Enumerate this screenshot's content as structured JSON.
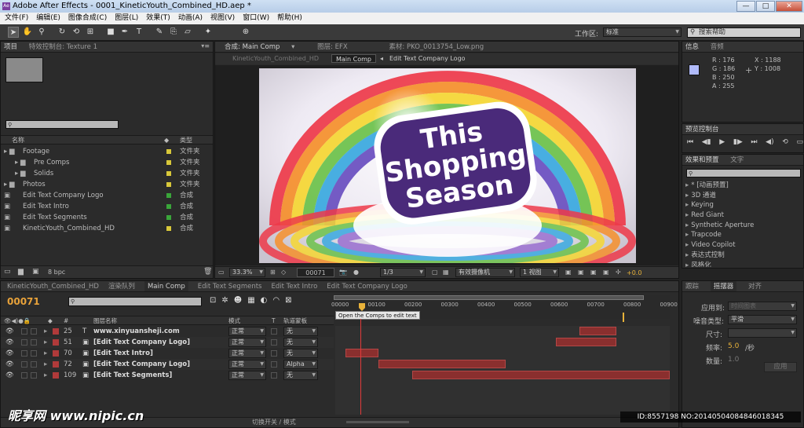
{
  "window": {
    "title": "Adobe After Effects - 0001_KineticYouth_Combined_HD.aep *",
    "app_icon": "Ae",
    "minimize": "—",
    "maximize": "□",
    "close": "✕"
  },
  "menu": [
    "文件(F)",
    "编辑(E)",
    "图像合成(C)",
    "图层(L)",
    "效果(T)",
    "动画(A)",
    "视图(V)",
    "窗口(W)",
    "帮助(H)"
  ],
  "toolbar": {
    "workspace_label": "工作区:",
    "workspace_value": "标准",
    "search_placeholder": "搜索帮助"
  },
  "project": {
    "tabs": [
      "项目",
      "特效控制台: Texture 1"
    ],
    "col_name": "名称",
    "col_type": "类型",
    "bpc": "8 bpc",
    "items": [
      {
        "name": "Footage",
        "type": "文件夹",
        "color": "#d8c83a",
        "icon": "▸ ▆",
        "indent": 0
      },
      {
        "name": "Pre Comps",
        "type": "文件夹",
        "color": "#d8c83a",
        "icon": "▸ ▆",
        "indent": 1
      },
      {
        "name": "Solids",
        "type": "文件夹",
        "color": "#d8c83a",
        "icon": "▸ ▆",
        "indent": 1
      },
      {
        "name": "Photos",
        "type": "文件夹",
        "color": "#d8c83a",
        "icon": "▸ ▆",
        "indent": 0
      },
      {
        "name": "Edit Text Company Logo",
        "type": "合成",
        "color": "#3aa63a",
        "icon": "▣",
        "indent": 0
      },
      {
        "name": "Edit Text Intro",
        "type": "合成",
        "color": "#3aa63a",
        "icon": "▣",
        "indent": 0
      },
      {
        "name": "Edit Text Segments",
        "type": "合成",
        "color": "#3aa63a",
        "icon": "▣",
        "indent": 0
      },
      {
        "name": "KineticYouth_Combined_HD",
        "type": "合成",
        "color": "#d8c83a",
        "icon": "▣",
        "indent": 0
      }
    ]
  },
  "viewer": {
    "tabs": [
      "合成: Main Comp",
      "图层: EFX",
      "素材: PKO_0013754_Low.png"
    ],
    "breadcrumbs": [
      "KineticYouth_Combined_HD",
      "Main Comp",
      "Edit Text Company Logo"
    ],
    "headline": [
      "This",
      "Shopping",
      "Season"
    ],
    "footer": {
      "zoom": "33.3%",
      "timecode": "00071",
      "resolution": "1/3",
      "camera": "有效摄像机",
      "views": "1 视图",
      "exposure": "+0.0"
    }
  },
  "info": {
    "tabs": [
      "信息",
      "音频"
    ],
    "r": "R : 176",
    "g": "G : 186",
    "b": "B : 250",
    "a": "A : 255",
    "x": "X : 1188",
    "y": "Y : 1008",
    "swatch": "#b0bafa"
  },
  "preview": {
    "title": "预览控制台",
    "controls": [
      "⏮",
      "◀▮",
      "▶",
      "▮▶",
      "⏭",
      "◀)",
      "⟲",
      "▭"
    ]
  },
  "effects": {
    "tabs": [
      "效果和预置",
      "文字"
    ],
    "items": [
      "* [动画预置]",
      "3D 通道",
      "Keying",
      "Red Giant",
      "Synthetic Aperture",
      "Trapcode",
      "Video Copilot",
      "表达式控制",
      "风格化"
    ]
  },
  "timeline": {
    "tabs": [
      "KineticYouth_Combined_HD",
      "渲染队列",
      "Main Comp",
      "Edit Text Segments",
      "Edit Text Intro",
      "Edit Text Company Logo"
    ],
    "timecode": "00071",
    "col_num": "#",
    "col_name": "图层名称",
    "col_mode": "模式",
    "col_t": "T",
    "col_trkmat": "轨道蒙板",
    "toggle": "切换开关 / 模式",
    "ruler": [
      "00000",
      "00100",
      "00200",
      "00300",
      "00400",
      "00500",
      "00600",
      "00700",
      "00800",
      "00900"
    ],
    "tooltip": "Open the Comps to edit text",
    "layers": [
      {
        "num": "25",
        "name": "www.xinyuansheji.com",
        "mode": "正常",
        "trk": "无",
        "color": "#b03a3a",
        "icon": "T",
        "bar": [
          0.73,
          0.84
        ]
      },
      {
        "num": "51",
        "name": "[Edit Text Company Logo]",
        "mode": "正常",
        "trk": "无",
        "color": "#b03a3a",
        "icon": "▣",
        "bar": [
          0.66,
          0.84
        ]
      },
      {
        "num": "70",
        "name": "[Edit Text Intro]",
        "mode": "正常",
        "trk": "无",
        "color": "#b03a3a",
        "icon": "▣",
        "bar": [
          0.03,
          0.13
        ]
      },
      {
        "num": "72",
        "name": "[Edit Text Company Logo]",
        "mode": "正常",
        "trk": "Alpha",
        "color": "#b03a3a",
        "icon": "▣",
        "bar": [
          0.13,
          0.51
        ]
      },
      {
        "num": "109",
        "name": "[Edit Text Segments]",
        "mode": "正常",
        "trk": "无",
        "color": "#b03a3a",
        "icon": "▣",
        "bar": [
          0.23,
          1.0
        ]
      }
    ]
  },
  "wiggler": {
    "tabs": [
      "跟踪",
      "摇摆器",
      "对齐"
    ],
    "apply_label": "应用到:",
    "apply_value": "时间图表",
    "noise_label": "噪音类型:",
    "noise_value": "平滑",
    "dim_label": "尺寸:",
    "freq_label": "频率:",
    "freq_value": "5.0",
    "freq_unit": "/秒",
    "mag_label": "数量:",
    "mag_value": "1.0",
    "apply_button": "应用"
  },
  "watermark": {
    "brand": "昵享网 www.nipic.cn",
    "id": "ID:8557198 NO:20140504084846018345"
  }
}
